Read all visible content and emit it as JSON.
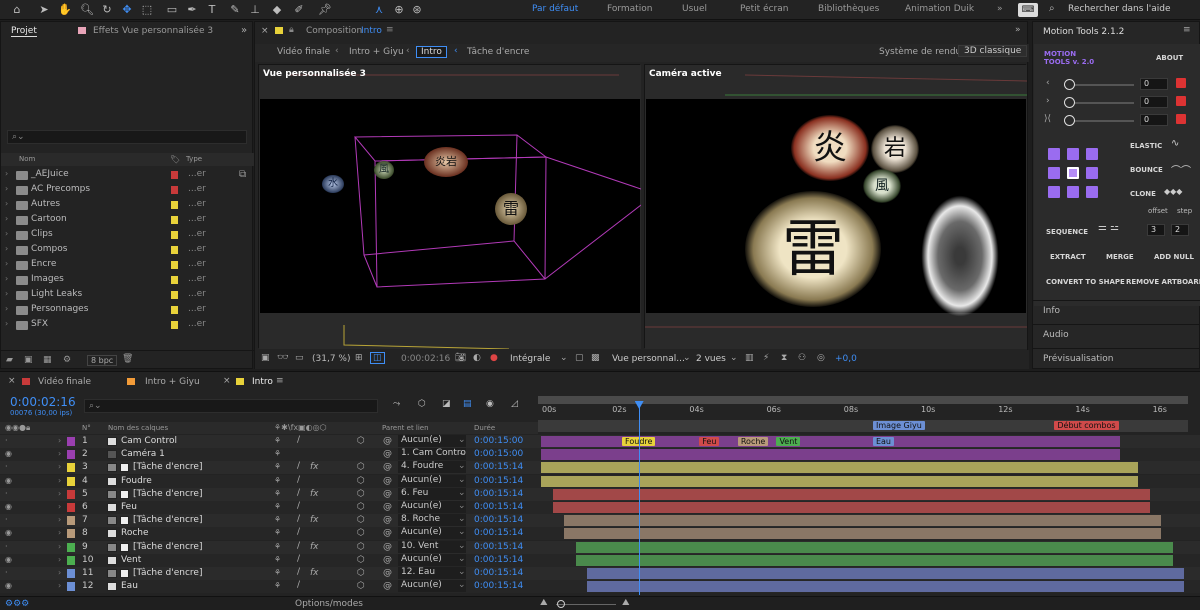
{
  "toolbar": {
    "workspaces": [
      "Par défaut",
      "Formation",
      "Usuel",
      "Petit écran",
      "Bibliothèques",
      "Animation Duik"
    ],
    "active_workspace": "Par défaut",
    "search_placeholder": "Rechercher dans l'aide"
  },
  "project_panel": {
    "tabs": [
      "Projet",
      "Effets",
      "Vue personnalisée 3"
    ],
    "search_placeholder": "",
    "col_name": "Nom",
    "col_type": "Type",
    "items": [
      {
        "name": "_AEJuice",
        "type": "...er",
        "color": "#c83a3a"
      },
      {
        "name": "AC Precomps",
        "type": "...er",
        "color": "#c83a3a"
      },
      {
        "name": "Autres",
        "type": "...er",
        "color": "#e8d23a"
      },
      {
        "name": "Cartoon",
        "type": "...er",
        "color": "#e8d23a"
      },
      {
        "name": "Clips",
        "type": "...er",
        "color": "#e8d23a"
      },
      {
        "name": "Compos",
        "type": "...er",
        "color": "#e8d23a"
      },
      {
        "name": "Encre",
        "type": "...er",
        "color": "#e8d23a"
      },
      {
        "name": "Images",
        "type": "...er",
        "color": "#e8d23a"
      },
      {
        "name": "Light Leaks",
        "type": "...er",
        "color": "#e8d23a"
      },
      {
        "name": "Personnages",
        "type": "...er",
        "color": "#e8d23a"
      },
      {
        "name": "SFX",
        "type": "...er",
        "color": "#e8d23a"
      }
    ],
    "bpc": "8 bpc"
  },
  "composition": {
    "tab_label": "Composition",
    "comp_name": "Intro",
    "breadcrumbs": [
      "Vidéo finale",
      "Intro + Giyu",
      "Intro",
      "Tâche d'encre"
    ],
    "renderer_label": "Système de rendu :",
    "renderer_value": "3D classique",
    "left_view_label": "Vue personnalisée 3",
    "right_view_label": "Caméra active",
    "zoom": "(31,7 %)",
    "timecode": "0:00:02:16",
    "resolution": "Intégrale",
    "view_mode": "Vue personnal...",
    "views": "2 vues",
    "exposure": "+0,0",
    "glyphs": {
      "g1": "炎",
      "g2": "岩",
      "g3": "風",
      "g4": "雷",
      "g5": "水"
    }
  },
  "motion_tools": {
    "title": "Motion Tools 2.1.2",
    "logo_line1": "MOTION",
    "logo_line2": "TOOLS v. 2.0",
    "about": "ABOUT",
    "slider_values": [
      "0",
      "0",
      "0"
    ],
    "buttons": {
      "elastic": "ELASTIC",
      "bounce": "BOUNCE",
      "clone": "CLONE",
      "offset": "offset",
      "step": "step",
      "sequence": "SEQUENCE",
      "seq_a": "3",
      "seq_b": "2",
      "extract": "EXTRACT",
      "merge": "MERGE",
      "add_null": "ADD NULL",
      "convert": "CONVERT TO SHAPE",
      "remove_artboard": "REMOVE ARTBOARD"
    },
    "sections": [
      "Info",
      "Audio",
      "Prévisualisation"
    ]
  },
  "timeline": {
    "tabs": [
      "Vidéo finale",
      "Intro + Giyu",
      "Intro"
    ],
    "timecode": "0:00:02:16",
    "frame_info": "00076 (30,00 ips)",
    "col_n": "N°",
    "col_name": "Nom des calques",
    "col_parent": "Parent et lien",
    "col_duration": "Durée",
    "ruler": [
      "00s",
      "02s",
      "04s",
      "06s",
      "08s",
      "10s",
      "12s",
      "14s",
      "16s"
    ],
    "options_label": "Options/modes",
    "markers": [
      {
        "label": "Image Giyu",
        "color": "#6c8fd4",
        "time": 8.6
      },
      {
        "label": "Début combos",
        "color": "#d04a4a",
        "time": 13.3
      }
    ],
    "keyframes": [
      {
        "label": "Foudre",
        "color": "#e8d23a",
        "time": 2.1
      },
      {
        "label": "Feu",
        "color": "#d04a4a",
        "time": 4.1
      },
      {
        "label": "Roche",
        "color": "#b89a7a",
        "time": 5.1
      },
      {
        "label": "Vent",
        "color": "#4caf50",
        "time": 6.1
      },
      {
        "label": "Eau",
        "color": "#6c8fd4",
        "time": 8.6
      }
    ],
    "playhead_time": 2.53,
    "layers": [
      {
        "n": "1",
        "name": "Cam Control",
        "parent": "Aucun(e)",
        "duration": "0:00:15:00",
        "color": "#9a3fb0",
        "bar_color": "#7b3f8c",
        "start": 0,
        "end": 15.0
      },
      {
        "n": "2",
        "name": "Caméra 1",
        "parent": "1. Cam Contro",
        "duration": "0:00:15:00",
        "color": "#9a3fb0",
        "bar_color": "#7b3f8c",
        "start": 0,
        "end": 15.0
      },
      {
        "n": "3",
        "name": "[Tâche d'encre]",
        "parent": "4. Foudre",
        "duration": "0:00:15:14",
        "color": "#e8d23a",
        "bar_color": "#a9a45a",
        "start": 0,
        "end": 15.47
      },
      {
        "n": "4",
        "name": "Foudre",
        "parent": "Aucun(e)",
        "duration": "0:00:15:14",
        "color": "#e8d23a",
        "bar_color": "#a9a45a",
        "start": 0,
        "end": 15.47
      },
      {
        "n": "5",
        "name": "[Tâche d'encre]",
        "parent": "6. Feu",
        "duration": "0:00:15:14",
        "color": "#c83a3a",
        "bar_color": "#a24848",
        "start": 0.3,
        "end": 15.77
      },
      {
        "n": "6",
        "name": "Feu",
        "parent": "Aucun(e)",
        "duration": "0:00:15:14",
        "color": "#c83a3a",
        "bar_color": "#a24848",
        "start": 0.3,
        "end": 15.77
      },
      {
        "n": "7",
        "name": "[Tâche d'encre]",
        "parent": "8. Roche",
        "duration": "0:00:15:14",
        "color": "#b89a7a",
        "bar_color": "#8a7766",
        "start": 0.6,
        "end": 16.07
      },
      {
        "n": "8",
        "name": "Roche",
        "parent": "Aucun(e)",
        "duration": "0:00:15:14",
        "color": "#b89a7a",
        "bar_color": "#8a7766",
        "start": 0.6,
        "end": 16.07
      },
      {
        "n": "9",
        "name": "[Tâche d'encre]",
        "parent": "10. Vent",
        "duration": "0:00:15:14",
        "color": "#4caf50",
        "bar_color": "#4a8a4c",
        "start": 0.9,
        "end": 16.37
      },
      {
        "n": "10",
        "name": "Vent",
        "parent": "Aucun(e)",
        "duration": "0:00:15:14",
        "color": "#4caf50",
        "bar_color": "#4a8a4c",
        "start": 0.9,
        "end": 16.37
      },
      {
        "n": "11",
        "name": "[Tâche d'encre]",
        "parent": "12. Eau",
        "duration": "0:00:15:14",
        "color": "#6c8fd4",
        "bar_color": "#5f6a9f",
        "start": 1.2,
        "end": 16.67
      },
      {
        "n": "12",
        "name": "Eau",
        "parent": "Aucun(e)",
        "duration": "0:00:15:14",
        "color": "#6c8fd4",
        "bar_color": "#5f6a9f",
        "start": 1.2,
        "end": 16.67
      }
    ]
  }
}
